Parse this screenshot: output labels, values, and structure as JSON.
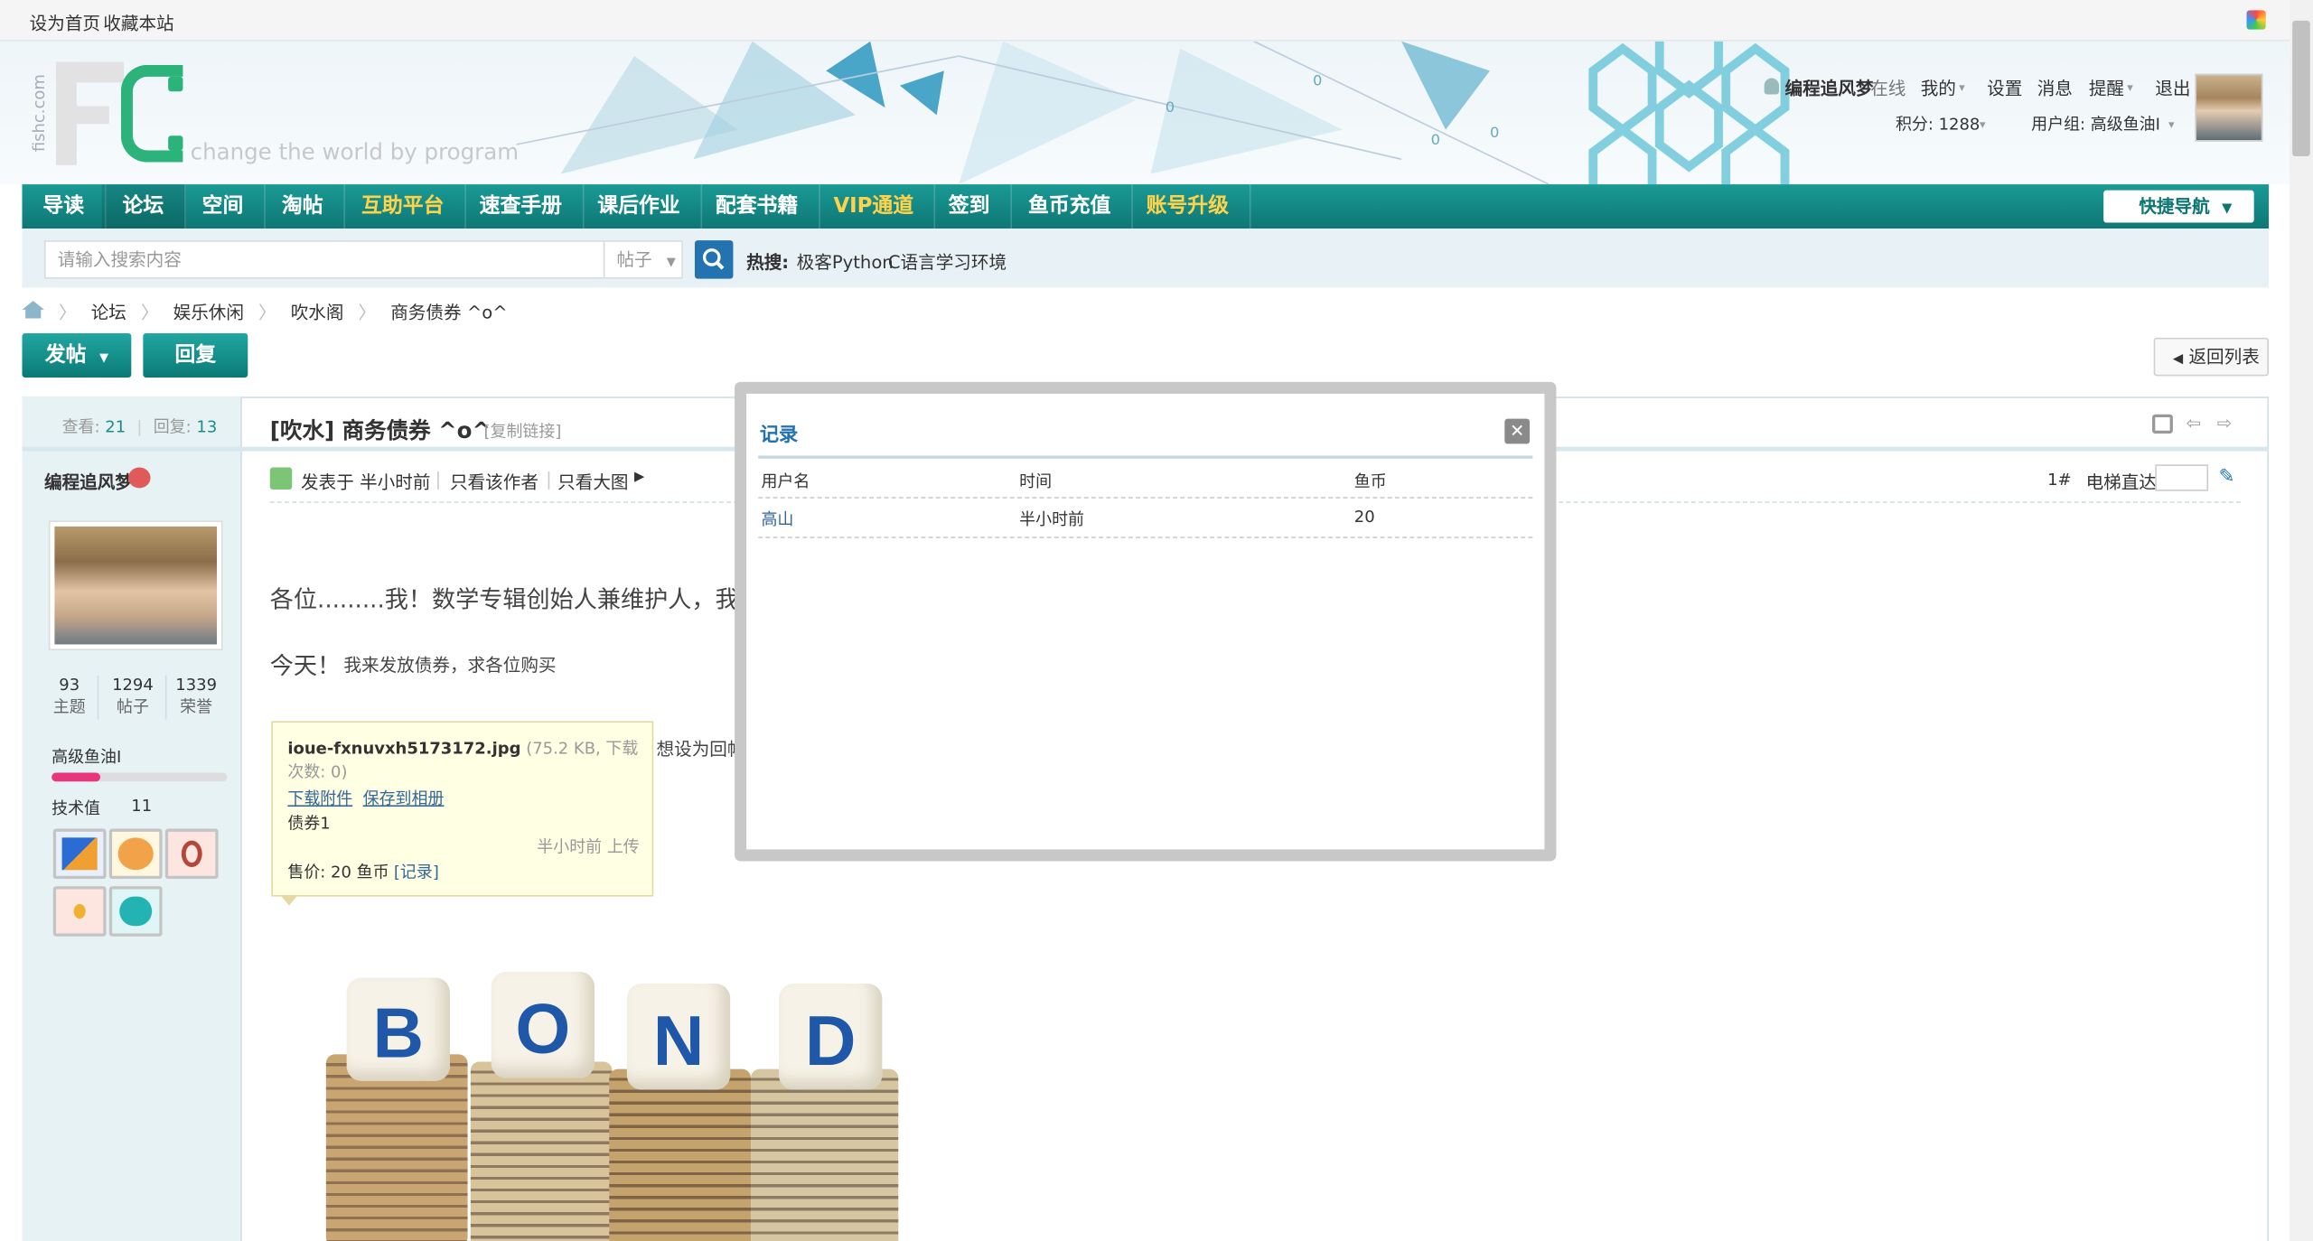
{
  "topbar": {
    "set_home": "设为首页",
    "bookmark": "收藏本站"
  },
  "header": {
    "logo_text": "FC",
    "logo_side": "fishc.com",
    "slogan": "change the world by program",
    "user": {
      "name": "编程追风梦",
      "status": "在线",
      "mine": "我的",
      "settings": "设置",
      "messages": "消息",
      "remind": "提醒",
      "logout": "退出",
      "points": "积分: 1288",
      "group": "用户组: 高级鱼油I"
    }
  },
  "nav": {
    "items": [
      {
        "label": "导读"
      },
      {
        "label": "论坛"
      },
      {
        "label": "空间"
      },
      {
        "label": "淘帖"
      },
      {
        "label": "互助平台"
      },
      {
        "label": "速查手册"
      },
      {
        "label": "课后作业"
      },
      {
        "label": "配套书籍"
      },
      {
        "label": "VIP通道"
      },
      {
        "label": "签到"
      },
      {
        "label": "鱼币充值"
      },
      {
        "label": "账号升级"
      }
    ],
    "quick_nav": "快捷导航"
  },
  "search": {
    "placeholder": "请输入搜索内容",
    "type": "帖子",
    "hot_label": "热搜:",
    "hot1": "极客Python",
    "hot2": "C语言学习环境"
  },
  "breadcrumb": {
    "forum": "论坛",
    "cat": "娱乐休闲",
    "board": "吹水阁",
    "thread": "商务债券 ^o^"
  },
  "actions": {
    "post": "发帖",
    "reply": "回复",
    "back": "返回列表"
  },
  "sidebar": {
    "views_label": "查看:",
    "views": "21",
    "replies_label": "回复:",
    "replies": "13",
    "author": "编程追风梦",
    "stats": [
      {
        "num": "93",
        "label": "主题"
      },
      {
        "num": "1294",
        "label": "帖子"
      },
      {
        "num": "1339",
        "label": "荣誉"
      }
    ],
    "group": "高级鱼油I",
    "group_progress": 0.28,
    "tech_label": "技术值",
    "tech": "11"
  },
  "post": {
    "title": "[吹水] 商务债券 ^o^",
    "copy_link": "[复制链接]",
    "posted": "发表于 半小时前",
    "only_author": "只看该作者",
    "only_big": "只看大图",
    "floor": "1#",
    "elevator": "电梯直达",
    "line1": "各位.........我！数学专辑创始人兼维护人，我",
    "line2_big": "今天！",
    "line2_small": "我来发放债券，求各位购买",
    "line3": "想设为回帖"
  },
  "attachment": {
    "filename": "ioue-fxnuvxh5173172.jpg",
    "meta": "(75.2 KB, 下载次数: 0)",
    "download": "下载附件",
    "save_album": "保存到相册",
    "desc": "债券1",
    "upload_time": "半小时前 上传",
    "price_label": "售价: 20 鱼币",
    "record_link": "[记录]"
  },
  "image": {
    "letters": [
      "B",
      "O",
      "N",
      "D"
    ]
  },
  "modal": {
    "title": "记录",
    "columns": [
      "用户名",
      "时间",
      "鱼币"
    ],
    "rows": [
      {
        "user": "高山",
        "time": "半小时前",
        "coins": "20"
      }
    ]
  }
}
